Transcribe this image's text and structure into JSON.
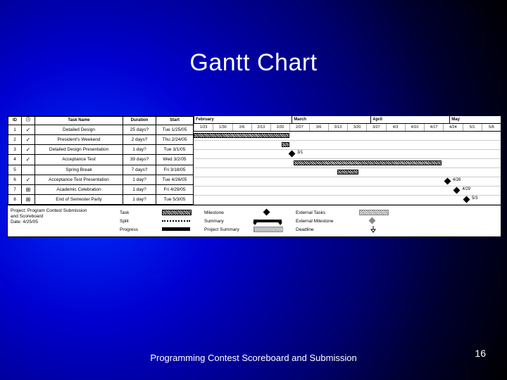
{
  "title": "Gantt Chart",
  "footer": "Programming Contest Scoreboard and Submission",
  "page_number": "16",
  "headers": {
    "id": "ID",
    "info": "ⓘ",
    "task": "Task Name",
    "dur": "Duration",
    "start": "Start"
  },
  "months": [
    {
      "label": "February",
      "span": 5
    },
    {
      "label": "March",
      "span": 4
    },
    {
      "label": "April",
      "span": 4
    },
    {
      "label": "May",
      "span": 2
    }
  ],
  "dates": [
    "1/23",
    "1/30",
    "2/6",
    "2/13",
    "2/20",
    "2/27",
    "3/6",
    "3/13",
    "3/20",
    "3/27",
    "4/3",
    "4/10",
    "4/17",
    "4/24",
    "5/1",
    "5/8"
  ],
  "tasks": [
    {
      "id": "1",
      "icon": "✓",
      "name": "Detailed Design",
      "dur": "25 days?",
      "start": "Tue 1/25/05",
      "bar": [
        0,
        5
      ]
    },
    {
      "id": "2",
      "icon": "✓",
      "name": "President's Weekend",
      "dur": "2 days?",
      "start": "Thu 2/24/05",
      "bar": [
        4.6,
        5
      ]
    },
    {
      "id": "3",
      "icon": "✓",
      "name": "Detailed Design Presentation",
      "dur": "1 day?",
      "start": "Tue 3/1/05",
      "mile": 5.1,
      "mlabel": "3/1"
    },
    {
      "id": "4",
      "icon": "✓",
      "name": "Acceptance Test",
      "dur": "39 days?",
      "start": "Wed 3/2/05",
      "bar": [
        5.2,
        12.9
      ]
    },
    {
      "id": "5",
      "icon": "",
      "name": "Spring Break",
      "dur": "7 days?",
      "start": "Fri 3/18/05",
      "bar": [
        7.5,
        8.6
      ]
    },
    {
      "id": "6",
      "icon": "✓",
      "name": "Acceptance Test Presentation",
      "dur": "1 day?",
      "start": "Tue 4/26/05",
      "mile": 13.2,
      "mlabel": "4/26"
    },
    {
      "id": "7",
      "icon": "⊞",
      "name": "Academic Celebration",
      "dur": "1 day?",
      "start": "Fri 4/29/05",
      "mile": 13.7,
      "mlabel": "4/29"
    },
    {
      "id": "8",
      "icon": "⊞",
      "name": "End of Semester Party",
      "dur": "1 day?",
      "start": "Tue 5/3/05",
      "mile": 14.2,
      "mlabel": "5/3"
    }
  ],
  "project_info": {
    "line1": "Project: Program Contest Submission",
    "line2": "and Scoreboard",
    "line3": "Date: 4/25/05"
  },
  "legend": {
    "task": "Task",
    "split": "Split",
    "progress": "Progress",
    "milestone": "Milestone",
    "summary": "Summary",
    "projsummary": "Project Summary",
    "exttasks": "External Tasks",
    "extmile": "External Milestone",
    "deadline": "Deadline"
  },
  "chart_data": {
    "type": "gantt",
    "title": "Gantt Chart",
    "project": "Program Contest Submission and Scoreboard",
    "status_date": "4/25/05",
    "x_axis": {
      "unit": "week",
      "ticks": [
        "1/23",
        "1/30",
        "2/6",
        "2/13",
        "2/20",
        "2/27",
        "3/6",
        "3/13",
        "3/20",
        "3/27",
        "4/3",
        "4/10",
        "4/17",
        "4/24",
        "5/1",
        "5/8"
      ],
      "month_groups": [
        "February",
        "March",
        "April",
        "May"
      ]
    },
    "tasks": [
      {
        "id": 1,
        "name": "Detailed Design",
        "start": "2005-01-25",
        "duration_days": 25,
        "type": "task",
        "complete": true
      },
      {
        "id": 2,
        "name": "President's Weekend",
        "start": "2005-02-24",
        "duration_days": 2,
        "type": "task",
        "complete": true
      },
      {
        "id": 3,
        "name": "Detailed Design Presentation",
        "start": "2005-03-01",
        "duration_days": 1,
        "type": "milestone",
        "complete": true
      },
      {
        "id": 4,
        "name": "Acceptance Test",
        "start": "2005-03-02",
        "duration_days": 39,
        "type": "task",
        "complete": true
      },
      {
        "id": 5,
        "name": "Spring Break",
        "start": "2005-03-18",
        "duration_days": 7,
        "type": "task",
        "complete": false
      },
      {
        "id": 6,
        "name": "Acceptance Test Presentation",
        "start": "2005-04-26",
        "duration_days": 1,
        "type": "milestone",
        "complete": true
      },
      {
        "id": 7,
        "name": "Academic Celebration",
        "start": "2005-04-29",
        "duration_days": 1,
        "type": "milestone",
        "complete": false
      },
      {
        "id": 8,
        "name": "End of Semester Party",
        "start": "2005-05-03",
        "duration_days": 1,
        "type": "milestone",
        "complete": false
      }
    ],
    "legend_entries": [
      "Task",
      "Split",
      "Progress",
      "Milestone",
      "Summary",
      "Project Summary",
      "External Tasks",
      "External Milestone",
      "Deadline"
    ]
  }
}
